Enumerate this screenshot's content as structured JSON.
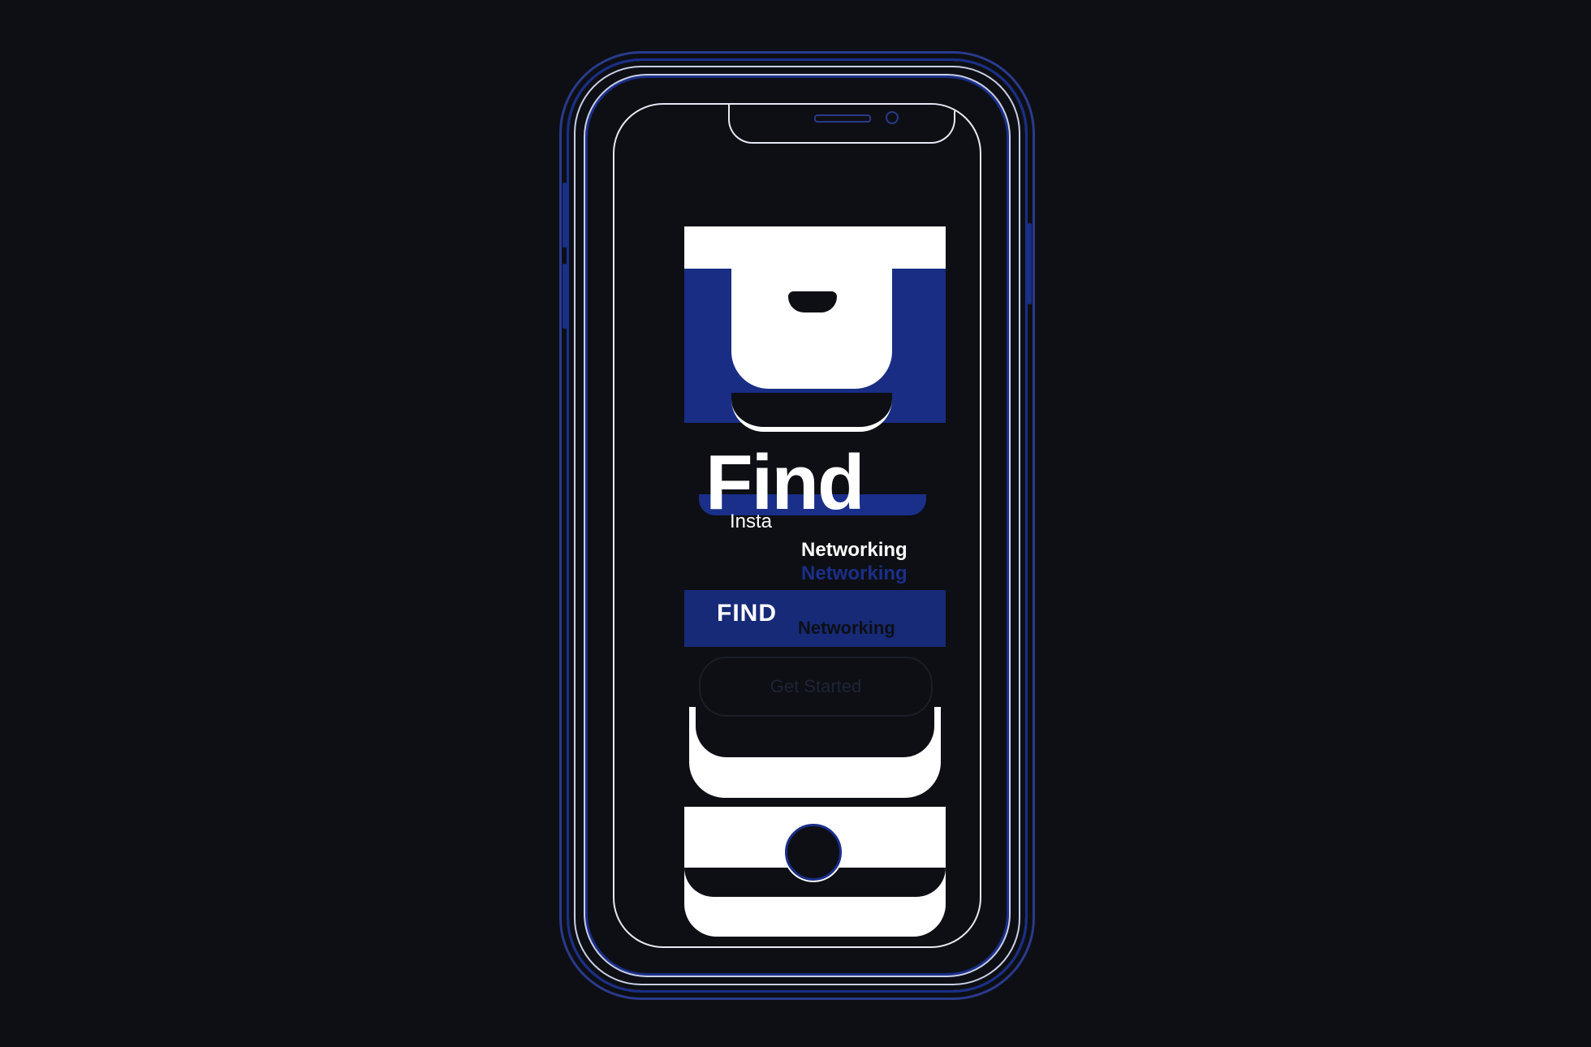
{
  "app": {
    "title": "Find",
    "tagline_left": "Insta",
    "tagline_right": "Networking",
    "feature": "FIND",
    "feature_sub": "Networking"
  },
  "cta": {
    "label": "Get Started"
  },
  "colors": {
    "background": "#0d0f14",
    "accent": "#1a2f8a",
    "primary": "#ffffff"
  },
  "icons": {
    "logo": "find-logo-icon",
    "home": "home-button-icon",
    "camera": "front-camera-icon"
  }
}
